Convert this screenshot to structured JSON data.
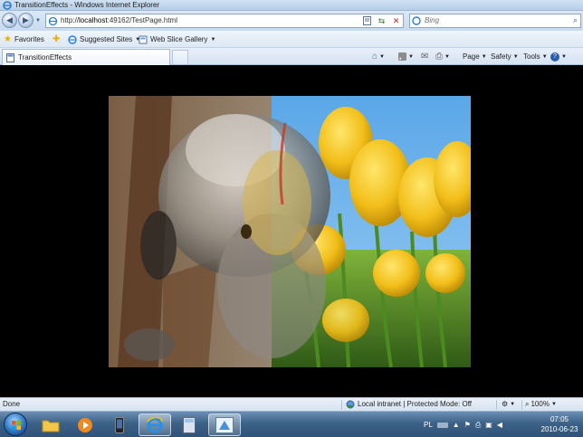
{
  "window": {
    "title": "TransitionEffects - Windows Internet Explorer"
  },
  "navigation": {
    "back_icon": "back-arrow-icon",
    "forward_icon": "forward-arrow-icon",
    "url_prefix": "http://",
    "url_host": "localhost",
    "url_rest": ":49162/TestPage.html"
  },
  "search": {
    "placeholder": "Bing"
  },
  "favorites_bar": {
    "favorites_label": "Favorites",
    "suggested_sites_label": "Suggested Sites",
    "web_slice_gallery_label": "Web Slice Gallery"
  },
  "tabs": [
    {
      "label": "TransitionEffects"
    }
  ],
  "command_bar": {
    "page_label": "Page",
    "safety_label": "Safety",
    "tools_label": "Tools"
  },
  "status_bar": {
    "status_text": "Done",
    "zone_text": "Local intranet | Protected Mode: Off",
    "zoom_text": "100%"
  },
  "taskbar": {
    "language": "PL",
    "time": "07:05",
    "date": "2010-06-23"
  },
  "colors": {
    "chrome_blue": "#c8dbef",
    "content_background": "#000000",
    "taskbar": "#3d6288"
  }
}
